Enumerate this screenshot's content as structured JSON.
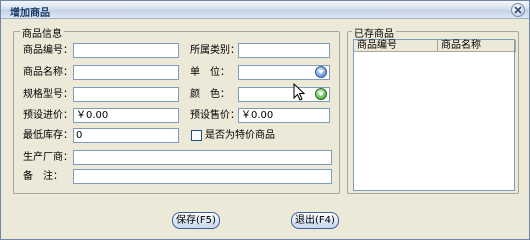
{
  "window": {
    "title": "增加商品"
  },
  "group_info": {
    "title": "商品信息",
    "product_code_label": "商品编号：",
    "category_label": "所属类别：",
    "product_name_label": "商品名称：",
    "unit_label": "单　位：",
    "spec_label": "规格型号：",
    "color_label": "颜　色：",
    "purchase_price_label": "预设进价：",
    "purchase_price_value": "￥0.00",
    "sale_price_label": "预设售价：",
    "sale_price_value": "￥0.00",
    "min_stock_label": "最低库存：",
    "min_stock_value": "0",
    "special_checkbox_label": "是否为特价商品",
    "manufacturer_label": "生产厂商：",
    "remark_label": "备　注："
  },
  "group_existing": {
    "title": "已存商品",
    "columns": [
      "商品编号",
      "商品名称"
    ]
  },
  "buttons": {
    "save": "保存(F5)",
    "exit": "退出(F4)"
  },
  "colors": {
    "window_bg": "#ece9d8",
    "field_border": "#7f9db9",
    "title_text": "#1a3a6b"
  }
}
